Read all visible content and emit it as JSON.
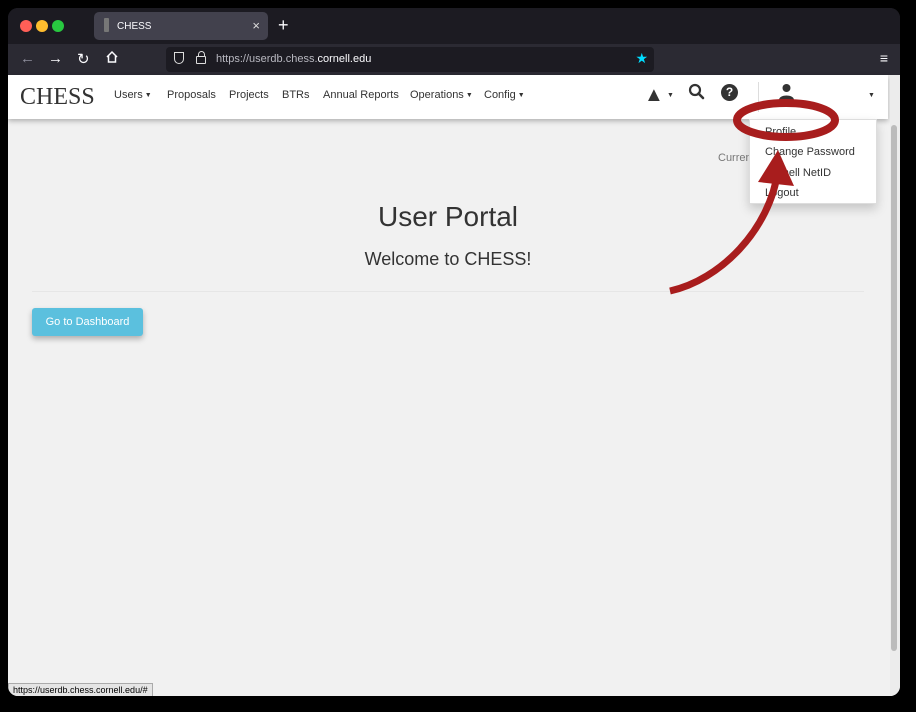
{
  "browser": {
    "tab_title": "CHESS",
    "new_tab_label": "+",
    "close_tab_label": "×",
    "url_prefix": "https://userdb.chess.",
    "url_host": "cornell.edu",
    "status_url": "https://userdb.chess.cornell.edu/#"
  },
  "navbar": {
    "brand": "CHESS",
    "items": [
      {
        "label": "Users",
        "has_caret": true
      },
      {
        "label": "Proposals",
        "has_caret": false
      },
      {
        "label": "Projects",
        "has_caret": false
      },
      {
        "label": "BTRs",
        "has_caret": false
      },
      {
        "label": "Annual Reports",
        "has_caret": false
      },
      {
        "label": "Operations",
        "has_caret": true
      },
      {
        "label": "Config",
        "has_caret": true
      }
    ]
  },
  "user_menu": {
    "items": [
      "Profile",
      "Change Password",
      "Cornell NetID",
      "Logout"
    ]
  },
  "main": {
    "currently_text": "Curren",
    "title": "User Portal",
    "subtitle": "Welcome to CHESS!",
    "dashboard_button": "Go to Dashboard"
  },
  "annotation": {
    "color": "#a81d1d",
    "highlighted_item": "Profile"
  },
  "icons": [
    "back-arrow-icon",
    "forward-arrow-icon",
    "reload-icon",
    "home-icon",
    "shield-icon",
    "lock-icon",
    "star-icon",
    "hamburger-menu-icon",
    "warning-icon",
    "search-icon",
    "help-icon",
    "user-icon"
  ]
}
